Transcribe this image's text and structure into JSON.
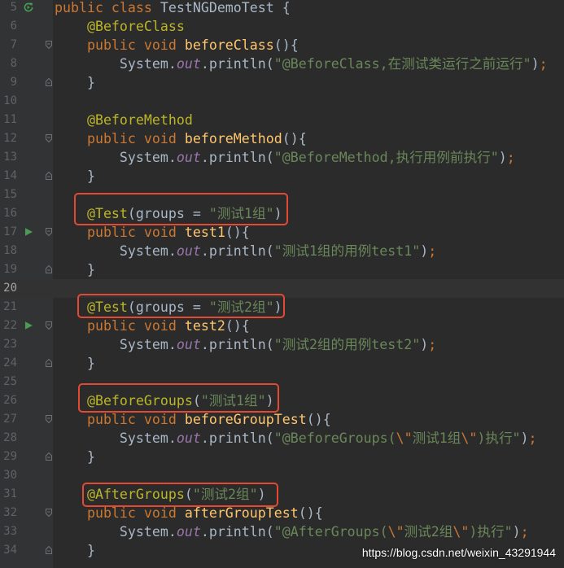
{
  "theme": {
    "editor_bg": "#2b2b2b",
    "gutter_bg": "#313335",
    "current_line_bg": "#323232",
    "line_number": "#606366",
    "current_line_number": "#a4a3a3",
    "plain": "#a9b7c6",
    "keyword": "#cc7832",
    "annotation": "#bbb529",
    "method_name": "#ffc66d",
    "string": "#6a8759",
    "escape": "#cc7832",
    "static_field": "#9876aa",
    "run_icon": "#499c54",
    "fold_icon": "#6e7073",
    "annotation_box": "#e24a33",
    "watermark": "#ffffff"
  },
  "editor": {
    "current_line": 20,
    "lines": [
      {
        "n": 5,
        "gutter_icon": "run-class-icon",
        "tokens": [
          {
            "t": "public class",
            "c": "kw"
          },
          {
            "t": " TestNGDemoTest {",
            "c": "plain"
          }
        ]
      },
      {
        "n": 6,
        "tokens": [
          {
            "t": "    @BeforeClass",
            "c": "ann"
          }
        ]
      },
      {
        "n": 7,
        "fold_icon": "fold-start-icon",
        "tokens": [
          {
            "t": "    public void ",
            "c": "kw"
          },
          {
            "t": "beforeClass",
            "c": "fn"
          },
          {
            "t": "(){",
            "c": "plain"
          }
        ]
      },
      {
        "n": 8,
        "tokens": [
          {
            "t": "        System.",
            "c": "plain"
          },
          {
            "t": "out",
            "c": "field"
          },
          {
            "t": ".println(",
            "c": "plain"
          },
          {
            "t": "\"@BeforeClass,在测试类运行之前运行\"",
            "c": "str"
          },
          {
            "t": ")",
            "c": "plain"
          },
          {
            "t": ";",
            "c": "kw"
          }
        ]
      },
      {
        "n": 9,
        "fold_icon": "fold-end-icon",
        "tokens": [
          {
            "t": "    }",
            "c": "plain"
          }
        ]
      },
      {
        "n": 10,
        "tokens": []
      },
      {
        "n": 11,
        "tokens": [
          {
            "t": "    @BeforeMethod",
            "c": "ann"
          }
        ]
      },
      {
        "n": 12,
        "fold_icon": "fold-start-icon",
        "tokens": [
          {
            "t": "    public void ",
            "c": "kw"
          },
          {
            "t": "beforeMethod",
            "c": "fn"
          },
          {
            "t": "(){",
            "c": "plain"
          }
        ]
      },
      {
        "n": 13,
        "tokens": [
          {
            "t": "        System.",
            "c": "plain"
          },
          {
            "t": "out",
            "c": "field"
          },
          {
            "t": ".println(",
            "c": "plain"
          },
          {
            "t": "\"@BeforeMethod,执行用例前执行\"",
            "c": "str"
          },
          {
            "t": ")",
            "c": "plain"
          },
          {
            "t": ";",
            "c": "kw"
          }
        ]
      },
      {
        "n": 14,
        "fold_icon": "fold-end-icon",
        "tokens": [
          {
            "t": "    }",
            "c": "plain"
          }
        ]
      },
      {
        "n": 15,
        "tokens": []
      },
      {
        "n": 16,
        "tokens": [
          {
            "t": "    @Test",
            "c": "ann"
          },
          {
            "t": "(groups = ",
            "c": "plain"
          },
          {
            "t": "\"测试1组\"",
            "c": "str"
          },
          {
            "t": ")",
            "c": "plain"
          }
        ]
      },
      {
        "n": 17,
        "gutter_icon": "run-test-icon",
        "fold_icon": "fold-start-icon",
        "tokens": [
          {
            "t": "    public void ",
            "c": "kw"
          },
          {
            "t": "test1",
            "c": "fn"
          },
          {
            "t": "(){",
            "c": "plain"
          }
        ]
      },
      {
        "n": 18,
        "tokens": [
          {
            "t": "        System.",
            "c": "plain"
          },
          {
            "t": "out",
            "c": "field"
          },
          {
            "t": ".println(",
            "c": "plain"
          },
          {
            "t": "\"测试1组的用例test1\"",
            "c": "str"
          },
          {
            "t": ")",
            "c": "plain"
          },
          {
            "t": ";",
            "c": "kw"
          }
        ]
      },
      {
        "n": 19,
        "fold_icon": "fold-end-icon",
        "tokens": [
          {
            "t": "    }",
            "c": "plain"
          }
        ]
      },
      {
        "n": 20,
        "tokens": []
      },
      {
        "n": 21,
        "tokens": [
          {
            "t": "    @Test",
            "c": "ann"
          },
          {
            "t": "(groups = ",
            "c": "plain"
          },
          {
            "t": "\"测试2组\"",
            "c": "str"
          },
          {
            "t": ")",
            "c": "plain"
          }
        ]
      },
      {
        "n": 22,
        "gutter_icon": "run-test-icon",
        "fold_icon": "fold-start-icon",
        "tokens": [
          {
            "t": "    public void ",
            "c": "kw"
          },
          {
            "t": "test2",
            "c": "fn"
          },
          {
            "t": "(){",
            "c": "plain"
          }
        ]
      },
      {
        "n": 23,
        "tokens": [
          {
            "t": "        System.",
            "c": "plain"
          },
          {
            "t": "out",
            "c": "field"
          },
          {
            "t": ".println(",
            "c": "plain"
          },
          {
            "t": "\"测试2组的用例test2\"",
            "c": "str"
          },
          {
            "t": ")",
            "c": "plain"
          },
          {
            "t": ";",
            "c": "kw"
          }
        ]
      },
      {
        "n": 24,
        "fold_icon": "fold-end-icon",
        "tokens": [
          {
            "t": "    }",
            "c": "plain"
          }
        ]
      },
      {
        "n": 25,
        "tokens": []
      },
      {
        "n": 26,
        "tokens": [
          {
            "t": "    @BeforeGroups",
            "c": "ann"
          },
          {
            "t": "(",
            "c": "plain"
          },
          {
            "t": "\"测试1组\"",
            "c": "str"
          },
          {
            "t": ")",
            "c": "plain"
          }
        ]
      },
      {
        "n": 27,
        "fold_icon": "fold-start-icon",
        "tokens": [
          {
            "t": "    public void ",
            "c": "kw"
          },
          {
            "t": "beforeGroupTest",
            "c": "fn"
          },
          {
            "t": "(){",
            "c": "plain"
          }
        ]
      },
      {
        "n": 28,
        "tokens": [
          {
            "t": "        System.",
            "c": "plain"
          },
          {
            "t": "out",
            "c": "field"
          },
          {
            "t": ".println(",
            "c": "plain"
          },
          {
            "t": "\"@BeforeGroups(",
            "c": "str"
          },
          {
            "t": "\\\"",
            "c": "esc"
          },
          {
            "t": "测试1组",
            "c": "str"
          },
          {
            "t": "\\\"",
            "c": "esc"
          },
          {
            "t": ")执行\"",
            "c": "str"
          },
          {
            "t": ")",
            "c": "plain"
          },
          {
            "t": ";",
            "c": "kw"
          }
        ]
      },
      {
        "n": 29,
        "fold_icon": "fold-end-icon",
        "tokens": [
          {
            "t": "    }",
            "c": "plain"
          }
        ]
      },
      {
        "n": 30,
        "tokens": []
      },
      {
        "n": 31,
        "tokens": [
          {
            "t": "    @AfterGroups",
            "c": "ann"
          },
          {
            "t": "(",
            "c": "plain"
          },
          {
            "t": "\"测试2组\"",
            "c": "str"
          },
          {
            "t": ")",
            "c": "plain"
          }
        ]
      },
      {
        "n": 32,
        "fold_icon": "fold-start-icon",
        "tokens": [
          {
            "t": "    public void ",
            "c": "kw"
          },
          {
            "t": "afterGroupTest",
            "c": "fn"
          },
          {
            "t": "(){",
            "c": "plain"
          }
        ]
      },
      {
        "n": 33,
        "tokens": [
          {
            "t": "        System.",
            "c": "plain"
          },
          {
            "t": "out",
            "c": "field"
          },
          {
            "t": ".println(",
            "c": "plain"
          },
          {
            "t": "\"@AfterGroups(",
            "c": "str"
          },
          {
            "t": "\\\"",
            "c": "esc"
          },
          {
            "t": "测试2组",
            "c": "str"
          },
          {
            "t": "\\\"",
            "c": "esc"
          },
          {
            "t": ")执行\"",
            "c": "str"
          },
          {
            "t": ")",
            "c": "plain"
          },
          {
            "t": ";",
            "c": "kw"
          }
        ]
      },
      {
        "n": 34,
        "fold_icon": "fold-end-icon",
        "tokens": [
          {
            "t": "    }",
            "c": "plain"
          }
        ]
      }
    ]
  },
  "watermark": "https://blog.csdn.net/weixin_43291944"
}
